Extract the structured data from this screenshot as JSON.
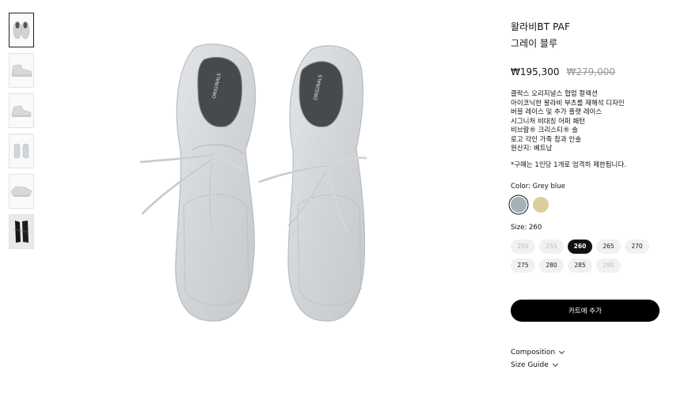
{
  "gallery": {
    "thumbnails": [
      {
        "view": "top-pair",
        "selected": true
      },
      {
        "view": "side"
      },
      {
        "view": "side-angle"
      },
      {
        "view": "back-pair"
      },
      {
        "view": "sole-angle"
      },
      {
        "view": "black-pair"
      }
    ]
  },
  "product": {
    "name": "왈라비BT PAF",
    "variant": "그레이 블루",
    "price": "₩195,300",
    "price_original": "₩279,000",
    "description": [
      "클락스 오리지널스 협업 컬렉션",
      "아이코닉한 왈라비 부츠를 재해석 디자인",
      "버블 레이스 및 추가 플랫 레이스",
      "시그니처 비대칭 어퍼 패턴",
      "비브람® 크리스티® 솔",
      "로고 각인 가죽 참과 인솔",
      "원산지: 베트남"
    ],
    "note": "*구매는 1인당 1개로 엄격히 제한됩니다."
  },
  "color": {
    "label": "Color: Grey blue",
    "options": [
      {
        "name": "grey-blue",
        "hex": "#a6b1b8",
        "selected": true
      },
      {
        "name": "sand",
        "hex": "#d9cf9e",
        "selected": false
      }
    ]
  },
  "size": {
    "label": "Size: 260",
    "options": [
      {
        "value": "250",
        "available": false,
        "selected": false
      },
      {
        "value": "255",
        "available": false,
        "selected": false
      },
      {
        "value": "260",
        "available": true,
        "selected": true
      },
      {
        "value": "265",
        "available": true,
        "selected": false
      },
      {
        "value": "270",
        "available": true,
        "selected": false
      },
      {
        "value": "275",
        "available": true,
        "selected": false
      },
      {
        "value": "280",
        "available": true,
        "selected": false
      },
      {
        "value": "285",
        "available": true,
        "selected": false
      },
      {
        "value": "290",
        "available": false,
        "selected": false
      }
    ]
  },
  "actions": {
    "add_to_cart": "카트에 추가"
  },
  "accordions": [
    {
      "label": "Composition"
    },
    {
      "label": "Size Guide"
    }
  ]
}
